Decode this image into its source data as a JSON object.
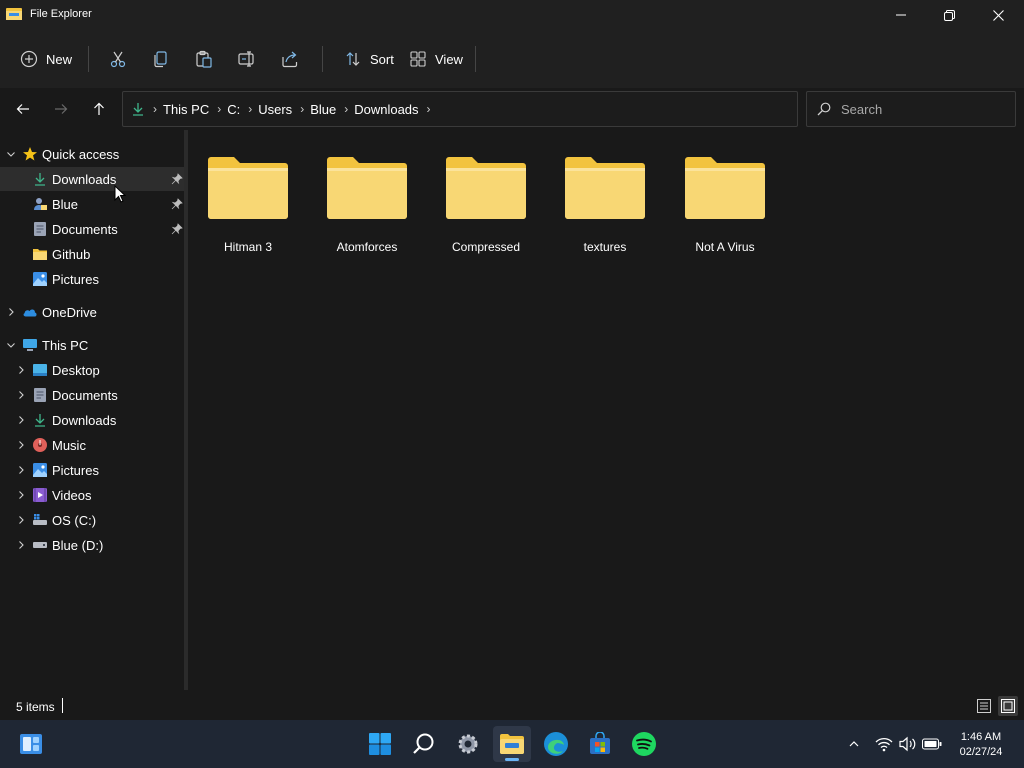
{
  "window": {
    "title": "File Explorer"
  },
  "toolbar": {
    "new_label": "New",
    "sort_label": "Sort",
    "view_label": "View"
  },
  "address": {
    "crumbs": [
      "This PC",
      "C:",
      "Users",
      "Blue",
      "Downloads"
    ]
  },
  "search": {
    "placeholder": "Search"
  },
  "sidebar": {
    "quick_access": "Quick access",
    "quick_items": [
      "Downloads",
      "Blue",
      "Documents",
      "Github",
      "Pictures"
    ],
    "onedrive": "OneDrive",
    "this_pc": "This PC",
    "pc_items": [
      "Desktop",
      "Documents",
      "Downloads",
      "Music",
      "Pictures",
      "Videos",
      "OS (C:)",
      "Blue (D:)"
    ]
  },
  "content": {
    "folders": [
      "Hitman 3",
      "Atomforces",
      "Compressed",
      "textures",
      "Not A Virus"
    ]
  },
  "status": {
    "item_count": "5 items"
  },
  "taskbar": {
    "time": "1:46 AM",
    "date": "02/27/24"
  },
  "colors": {
    "folder_yellow": "#f8d774",
    "folder_back": "#f2c33e",
    "accent": "#6ab4f5",
    "spotify": "#1ed760"
  }
}
